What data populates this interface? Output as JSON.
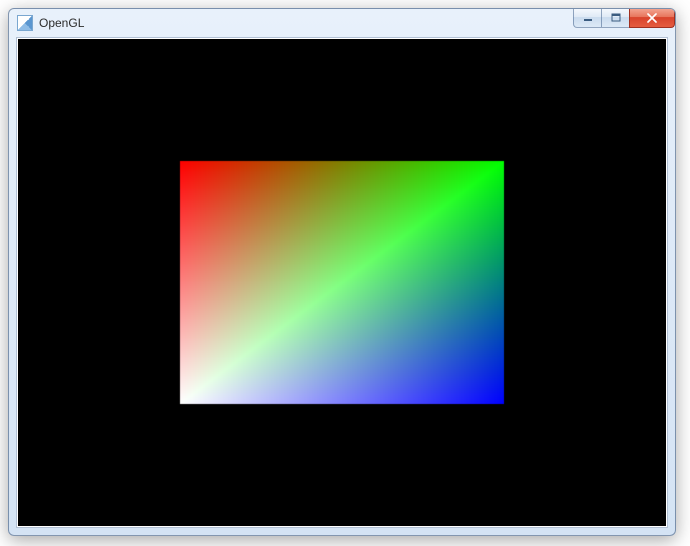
{
  "window": {
    "title": "OpenGL",
    "icon": "opengl-app-icon",
    "controls": {
      "minimize": "minimize",
      "maximize": "maximize",
      "close": "close"
    }
  },
  "viewport": {
    "background_color": "#000000",
    "quad": {
      "vertices": [
        {
          "pos": "top-left",
          "color": "#ff0000"
        },
        {
          "pos": "top-right",
          "color": "#00ff00"
        },
        {
          "pos": "bottom-right",
          "color": "#0000ff"
        },
        {
          "pos": "bottom-left",
          "color": "#ffffff"
        }
      ],
      "rect_ndc": {
        "x0": -0.5,
        "y0": -0.5,
        "x1": 0.5,
        "y1": 0.5
      }
    }
  }
}
